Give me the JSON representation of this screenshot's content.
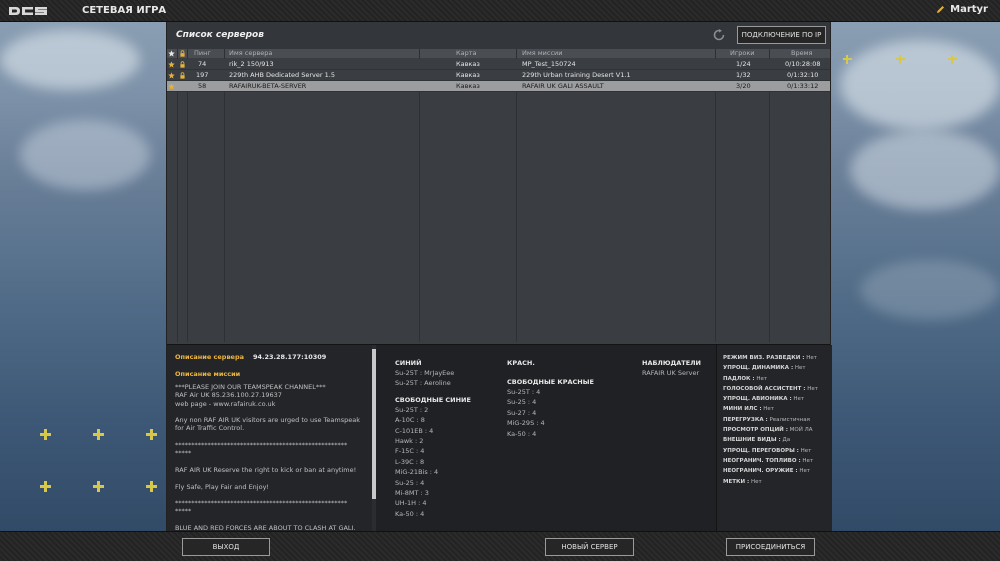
{
  "window": {
    "title": "СЕТЕВАЯ ИГРА",
    "user": "Martyr"
  },
  "panel": {
    "title": "Список серверов",
    "connect_ip_label": "ПОДКЛЮЧЕНИЕ ПО IP"
  },
  "table": {
    "headers": {
      "ping": "Пинг",
      "server_name": "Имя сервера",
      "map": "Карта",
      "mission_name": "Имя миссии",
      "players": "Игроки",
      "time": "Время"
    },
    "rows": [
      {
        "ping": "74",
        "server_name": "rik_2 150/913",
        "map": "Кавказ",
        "mission_name": "MP_Test_150724",
        "players": "1/24",
        "time": "0/10:28:08",
        "favorite": true,
        "locked": true
      },
      {
        "ping": "197",
        "server_name": "229th AHB Dedicated Server 1.5",
        "map": "Кавказ",
        "mission_name": "229th Urban training Desert V1.1",
        "players": "1/32",
        "time": "0/1:32:10",
        "favorite": true,
        "locked": true
      },
      {
        "ping": "58",
        "server_name": "RAFAIRUK-BETA-SERVER",
        "map": "Кавказ",
        "mission_name": "RAFAIR UK GALI ASSAULT",
        "players": "3/20",
        "time": "0/1:33:12",
        "favorite": true,
        "locked": false
      }
    ]
  },
  "details": {
    "server_description_label": "Описание сервера",
    "server_ip": "94.23.28.177:10309",
    "mission_description_label": "Описание миссии",
    "mission_description": "***PLEASE JOIN OUR TEAMSPEAK CHANNEL***\nRAF Air UK 85.236.100.27.19637\nweb page - www.rafairuk.co.uk\n\nAny non RAF AIR UK visitors are urged to use Teamspeak for Air Traffic Control.\n\n*****************************************************\n*****\n\nRAF AIR UK Reserve the right to kick or ban at anytime!\n\nFly Safe, Play Fair and Enjoy!\n\n*****************************************************\n*****\n\nBLUE AND RED FORCES ARE ABOUT TO CLASH AT GALI.",
    "blue": {
      "title": "СИНИЙ",
      "players": [
        "Su-25T : MrJayEee",
        "Su-25T : Aeroline"
      ],
      "free_title": "СВОБОДНЫЕ СИНИЕ",
      "free": [
        "Su-25T : 2",
        "A-10C : 8",
        "C-101EB : 4",
        "Hawk : 2",
        "F-15C : 4",
        "L-39C : 8",
        "MiG-21Bis : 4",
        "Su-25 : 4",
        "Mi-8MT : 3",
        "UH-1H : 4",
        "Ka-50 : 4"
      ]
    },
    "red": {
      "title": "КРАСН.",
      "free_title": "СВОБОДНЫЕ КРАСНЫЕ",
      "free": [
        "Su-25T : 4",
        "Su-25 : 4",
        "Su-27 : 4",
        "MiG-29S : 4",
        "Ka-50 : 4"
      ]
    },
    "observers": {
      "title": "НАБЛЮДАТЕЛИ",
      "players": [
        "RAFAIR UK Server"
      ]
    },
    "options": [
      {
        "key": "РЕЖИМ ВИЗ. РАЗВЕДКИ :",
        "value": "Нет"
      },
      {
        "key": "УПРОЩ. ДИНАМИКА :",
        "value": "Нет"
      },
      {
        "key": "ПАДЛОК :",
        "value": "Нет"
      },
      {
        "key": "ГОЛОСОВОЙ АССИСТЕНТ :",
        "value": "Нет"
      },
      {
        "key": "УПРОЩ. АВИОНИКА :",
        "value": "Нет"
      },
      {
        "key": "МИНИ ИЛС :",
        "value": "Нет"
      },
      {
        "key": "ПЕРЕГРУЗКА :",
        "value": "Реалистичная"
      },
      {
        "key": "ПРОСМОТР ОПЦИЙ :",
        "value": "МОЙ ЛА"
      },
      {
        "key": "ВНЕШНИЕ ВИДЫ :",
        "value": "Да"
      },
      {
        "key": "УПРОЩ. ПЕРЕГОВОРЫ :",
        "value": "Нет"
      },
      {
        "key": "НЕОГРАНИЧ. ТОПЛИВО :",
        "value": "Нет"
      },
      {
        "key": "НЕОГРАНИЧ. ОРУЖИЕ :",
        "value": "Нет"
      },
      {
        "key": "МЕТКИ :",
        "value": "Нет"
      }
    ]
  },
  "footer": {
    "exit_label": "ВЫХОД",
    "new_server_label": "НОВЫЙ СЕРВЕР",
    "join_label": "ПРИСОЕДИНИТЬСЯ"
  },
  "colors": {
    "accent": "#f0b83c",
    "selected_row": "#9c9d9f",
    "marker": "#d8c84a"
  }
}
